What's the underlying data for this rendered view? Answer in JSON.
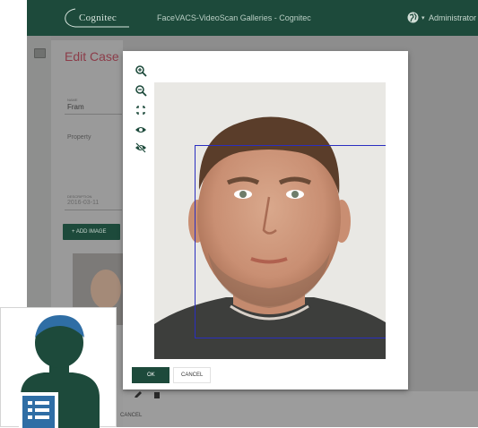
{
  "header": {
    "logo_text": "Cognitec",
    "app_title": "FaceVACS-VideoScan Galleries - Cognitec",
    "user_label": "Administrator ▾",
    "globe_icon": "globe-icon"
  },
  "edit_page": {
    "title": "Edit Case",
    "name_label": "NAME",
    "name_value": "Fram",
    "property_label": "Property",
    "description_label": "DESCRIPTION",
    "description_value": "2016-03-11",
    "add_image_label": "+ ADD IMAGE",
    "cancel_label": "CANCEL"
  },
  "image_dialog": {
    "tools": [
      "zoom-in-icon",
      "zoom-out-icon",
      "fit-to-screen-icon",
      "show-icon",
      "hide-icon"
    ],
    "ok_label": "OK",
    "cancel_label": "CANCEL"
  },
  "colors": {
    "header_bg": "#1d4a3b",
    "accent_title": "#8c3c49",
    "face_box": "#2a2fc0",
    "icon_teal": "#1d4a3b",
    "icon_blue": "#2f6ea5"
  }
}
